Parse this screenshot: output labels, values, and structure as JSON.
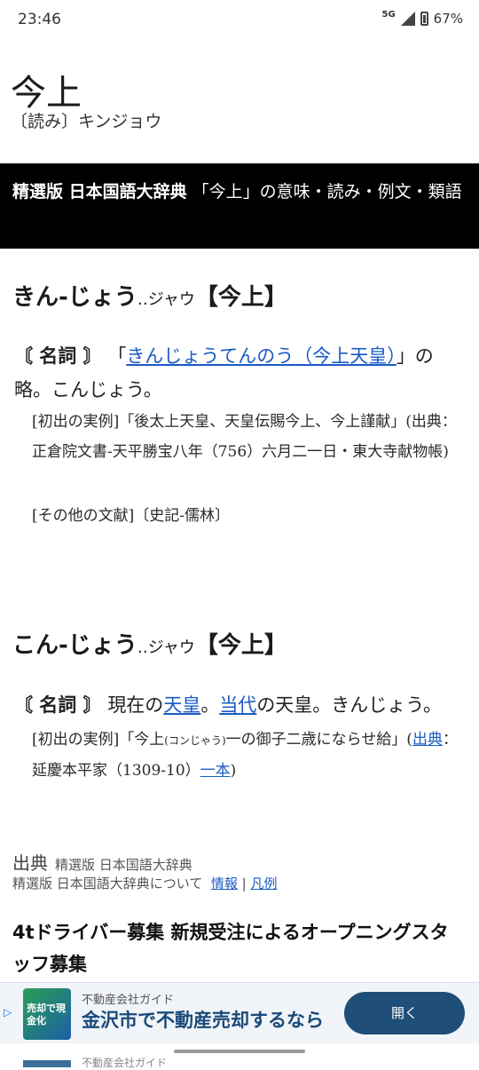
{
  "status_bar": {
    "time": "23:46",
    "network": "5G",
    "battery": "67%"
  },
  "header": {
    "title": "今上",
    "reading": "〔読み〕キンジョウ"
  },
  "banner": {
    "bold_text": "精選版 日本国語大辞典",
    "text": "「今上」の意味・読み・例文・類語"
  },
  "entries": [
    {
      "headword": "きん‐じょう",
      "kana_note": "‥ジャウ",
      "kanji": "【今上】",
      "pos": "〘 名詞 〙",
      "def_prefix": "「",
      "def_link": "きんじょうてんのう（今上天皇）",
      "def_suffix": "」の略。こんじょう。",
      "quotes": [
        "[初出の実例]「後太上天皇、天皇伝賜今上、今上謹献」(出典：正倉院文書‐天平勝宝八年（756）六月二一日・東大寺献物帳)",
        "[その他の文献]〔史記‐儒林〕"
      ]
    },
    {
      "headword": "こん‐じょう",
      "kana_note": "‥ジャウ",
      "kanji": "【今上】",
      "pos": "〘 名詞 〙",
      "def_text_1": "現在の",
      "def_link_1": "天皇",
      "def_text_2": "。",
      "def_link_2": "当代",
      "def_text_3": "の天皇。きんじょう。",
      "quote_prefix": "[初出の実例]「今上",
      "quote_ruby": "(コンじゃう)",
      "quote_mid": "一の御子二歳にならせ給」(",
      "quote_link_1": "出典",
      "quote_text": "：延慶本平家（1309‐10）",
      "quote_link_2": "一本",
      "quote_end": ")"
    }
  ],
  "source": {
    "label": "出典",
    "name": "精選版 日本国語大辞典",
    "about": "精選版 日本国語大辞典について",
    "info_link": "情報",
    "sep": "|",
    "legend_link": "凡例"
  },
  "ad_title": "4tドライバー募集 新規受注によるオープニングスタッフ募集",
  "bottom_ad": {
    "sponsor": "不動産会社ガイド",
    "headline": "金沢市で不動産売却するなら",
    "button": "開く",
    "thumb_text": "売却で現金化",
    "next_sponsor": "不動産会社ガイド"
  },
  "colors": {
    "link": "#1a5bc4",
    "banner_bg": "#000000",
    "ad_button": "#1f4e79"
  }
}
